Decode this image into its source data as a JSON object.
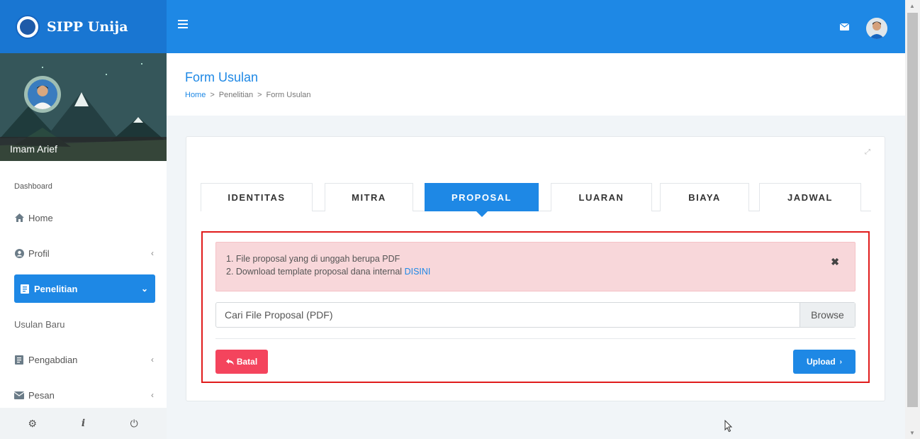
{
  "brand": {
    "name": "SIPP Unija"
  },
  "user": {
    "name": "Imam Arief"
  },
  "sidebar": {
    "header": "Dashboard",
    "items": [
      {
        "label": "Home",
        "icon": "home-icon"
      },
      {
        "label": "Profil",
        "icon": "user-circle-icon",
        "chevron": "‹"
      },
      {
        "label": "Penelitian",
        "icon": "document-icon",
        "chevron": "⌄",
        "active": true
      },
      {
        "label": "Usulan Baru"
      },
      {
        "label": "Pengabdian",
        "icon": "document-icon",
        "chevron": "‹"
      },
      {
        "label": "Pesan",
        "icon": "mail-icon",
        "chevron": "‹"
      }
    ],
    "footer": {
      "settings": "⚙",
      "info": "i",
      "power": "⏻"
    }
  },
  "page": {
    "title": "Form Usulan",
    "breadcrumb": [
      "Home",
      "Penelitian",
      "Form Usulan"
    ]
  },
  "tabs": [
    "IDENTITAS",
    "MITRA",
    "PROPOSAL",
    "LUARAN",
    "BIAYA",
    "JADWAL"
  ],
  "active_tab": "PROPOSAL",
  "alert": {
    "line1": "1. File proposal yang di unggah berupa PDF",
    "line2_prefix": "2. Download template proposal dana internal ",
    "line2_link": "DISINI",
    "close": "✖"
  },
  "file_input": {
    "placeholder": "Cari File Proposal (PDF)",
    "browse_label": "Browse"
  },
  "buttons": {
    "cancel_label": "Batal",
    "upload_label": "Upload"
  },
  "colors": {
    "primary": "#1e88e5",
    "danger": "#f4445d",
    "alert_bg": "#f8d7da",
    "highlight_border": "#e01c1c"
  }
}
